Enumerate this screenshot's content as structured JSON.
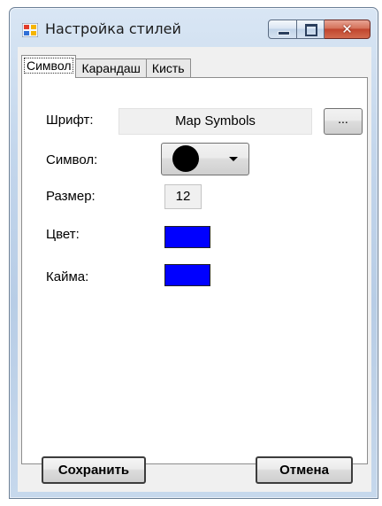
{
  "window": {
    "title": "Настройка стилей"
  },
  "caption": {
    "min": "minimize",
    "max": "maximize",
    "close": "close"
  },
  "tabs": [
    "Символ",
    "Карандаш",
    "Кисть"
  ],
  "form": {
    "font_label": "Шрифт:",
    "font_value": "Map Symbols",
    "browse_label": "...",
    "symbol_label": "Символ:",
    "symbol_glyph": "●",
    "size_label": "Размер:",
    "size_value": "12",
    "color_label": "Цвет:",
    "color_value": "#0000ff",
    "border_label": "Кайма:",
    "border_value": "#0000ff"
  },
  "buttons": {
    "save": "Сохранить",
    "cancel": "Отмена"
  },
  "icons": {
    "app": "palette-app-icon",
    "dropdown": "chevron-down-icon"
  }
}
